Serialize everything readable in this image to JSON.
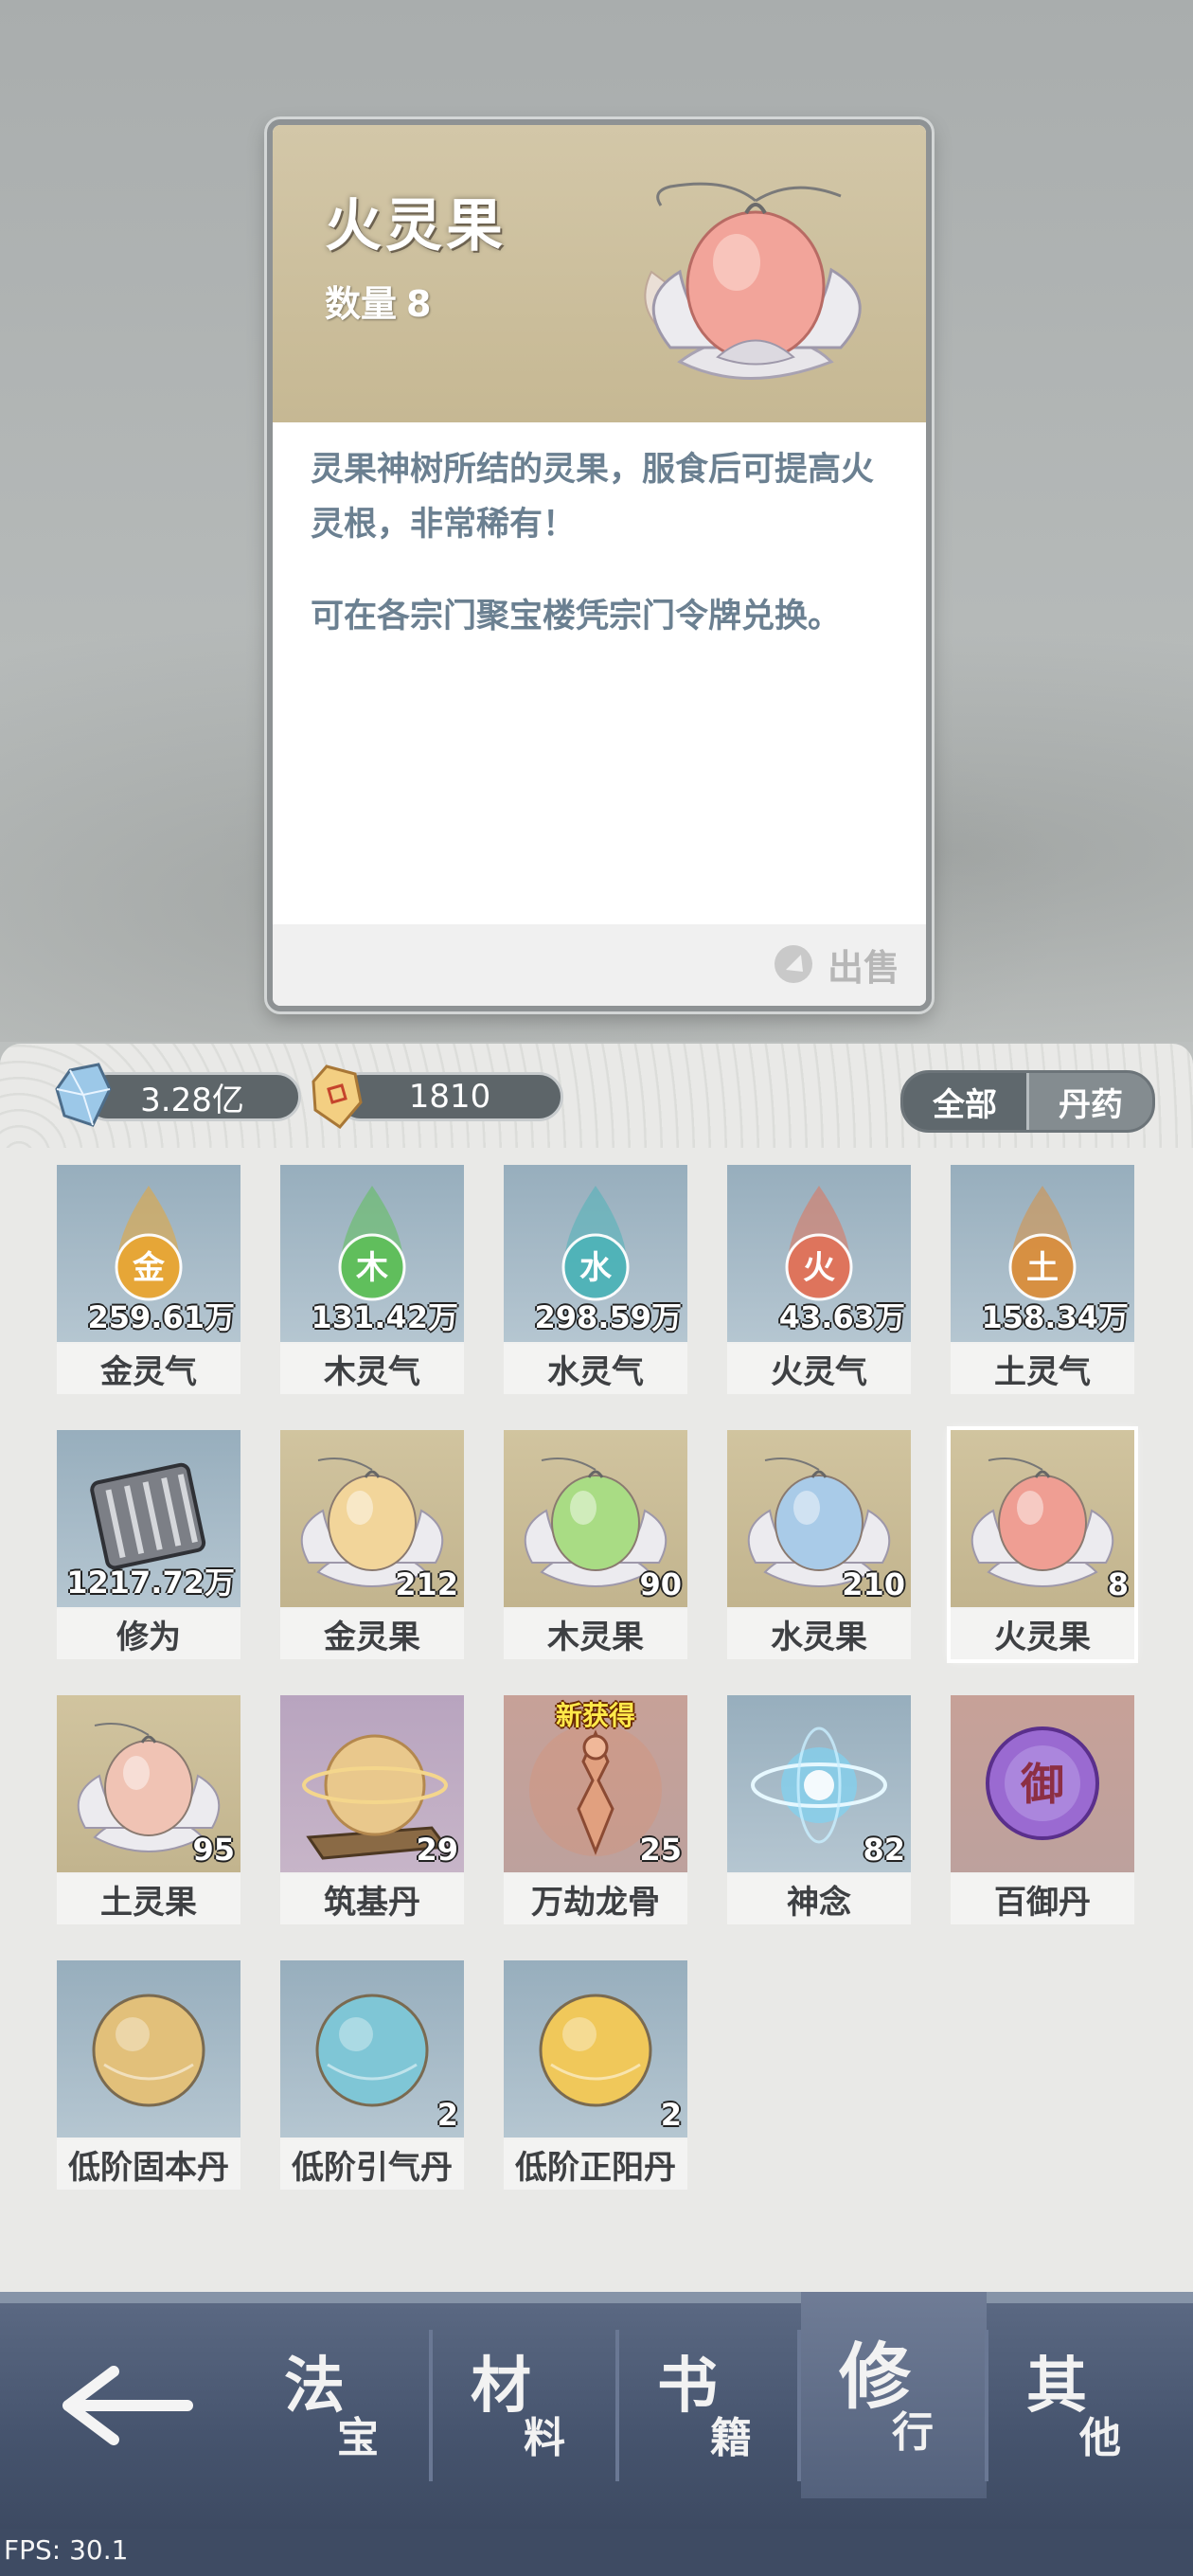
{
  "detail": {
    "title": "火灵果",
    "quantity_label": "数量",
    "quantity": "8",
    "description_1": "灵果神树所结的灵果，服食后可提高火灵根，非常稀有！",
    "description_2": "可在各宗门聚宝楼凭宗门令牌兑换。",
    "sell_label": "出售"
  },
  "currency": {
    "stones": "3.28亿",
    "gems": "1810"
  },
  "filters": [
    "全部",
    "丹药"
  ],
  "inventory": [
    {
      "name": "金灵气",
      "count": "259.61万",
      "bg": "blue",
      "icon": "gold-qi-icon",
      "color": "#e8a634",
      "glyph": "金"
    },
    {
      "name": "木灵气",
      "count": "131.42万",
      "bg": "blue",
      "icon": "wood-qi-icon",
      "color": "#5fbf5a",
      "glyph": "木"
    },
    {
      "name": "水灵气",
      "count": "298.59万",
      "bg": "blue",
      "icon": "water-qi-icon",
      "color": "#4fb3b8",
      "glyph": "水"
    },
    {
      "name": "火灵气",
      "count": "43.63万",
      "bg": "blue",
      "icon": "fire-qi-icon",
      "color": "#e0735a",
      "glyph": "火"
    },
    {
      "name": "土灵气",
      "count": "158.34万",
      "bg": "blue",
      "icon": "earth-qi-icon",
      "color": "#d98f3f",
      "glyph": "土"
    },
    {
      "name": "修为",
      "count": "1217.72万",
      "bg": "blue",
      "icon": "cultivation-scroll-icon"
    },
    {
      "name": "金灵果",
      "count": "212",
      "bg": "gold",
      "icon": "gold-fruit-icon",
      "color": "#f2d59a"
    },
    {
      "name": "木灵果",
      "count": "90",
      "bg": "gold",
      "icon": "wood-fruit-icon",
      "color": "#a9dc84"
    },
    {
      "name": "水灵果",
      "count": "210",
      "bg": "gold",
      "icon": "water-fruit-icon",
      "color": "#a9cbe8"
    },
    {
      "name": "火灵果",
      "count": "8",
      "bg": "gold",
      "icon": "fire-fruit-icon",
      "color": "#ef9e93",
      "selected": true
    },
    {
      "name": "土灵果",
      "count": "95",
      "bg": "gold",
      "icon": "earth-fruit-icon",
      "color": "#f0c3b4"
    },
    {
      "name": "筑基丹",
      "count": "29",
      "bg": "purple",
      "icon": "foundation-pill-icon",
      "color": "#e9c88c"
    },
    {
      "name": "万劫龙骨",
      "count": "25",
      "bg": "rose",
      "icon": "dragon-bone-icon",
      "color": "#d98e72",
      "new_label": "新获得"
    },
    {
      "name": "神念",
      "count": "82",
      "bg": "blue",
      "icon": "divine-sense-icon",
      "color": "#7fd3f2"
    },
    {
      "name": "百御丹",
      "count": "",
      "bg": "rose",
      "icon": "baiyu-pill-icon",
      "color": "#9a6ad1",
      "glyph": "御"
    },
    {
      "name": "低阶固本丹",
      "count": "",
      "bg": "blue",
      "icon": "guben-pill-icon",
      "color": "#e2c07a"
    },
    {
      "name": "低阶引气丹",
      "count": "2",
      "bg": "blue",
      "icon": "yinqi-pill-icon",
      "color": "#7fc6d6"
    },
    {
      "name": "低阶正阳丹",
      "count": "2",
      "bg": "blue",
      "icon": "zhengyang-pill-icon",
      "color": "#f0c85a"
    }
  ],
  "nav": {
    "tabs": [
      {
        "big": "法",
        "small": "宝"
      },
      {
        "big": "材",
        "small": "料"
      },
      {
        "big": "书",
        "small": "籍"
      },
      {
        "big": "修",
        "small": "行",
        "active": true
      },
      {
        "big": "其",
        "small": "他"
      }
    ]
  },
  "fps": "FPS: 30.1"
}
